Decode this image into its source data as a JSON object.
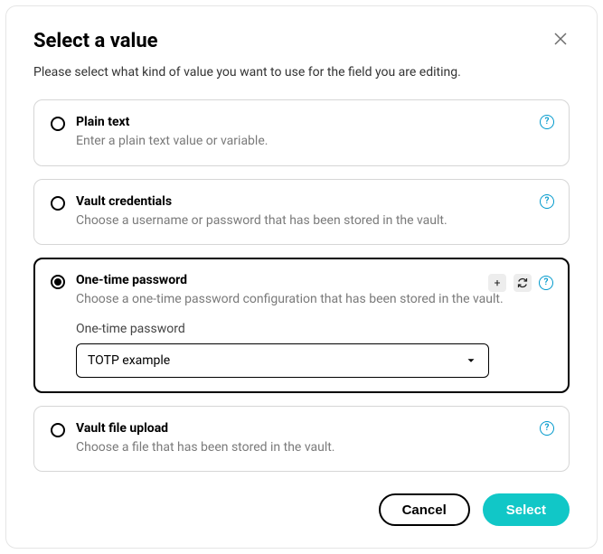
{
  "modal": {
    "title": "Select a value",
    "subtitle": "Please select what kind of value you want to use for the field you are editing."
  },
  "options": [
    {
      "key": "plain-text",
      "title": "Plain text",
      "desc": "Enter a plain text value or variable.",
      "selected": false,
      "has_add": false,
      "has_refresh": false
    },
    {
      "key": "vault-credentials",
      "title": "Vault credentials",
      "desc": "Choose a username or password that has been stored in the vault.",
      "selected": false,
      "has_add": false,
      "has_refresh": false
    },
    {
      "key": "one-time-password",
      "title": "One-time password",
      "desc": "Choose a one-time password configuration that has been stored in the vault.",
      "selected": true,
      "has_add": true,
      "has_refresh": true,
      "field_label": "One-time password",
      "selected_value": "TOTP example"
    },
    {
      "key": "vault-file-upload",
      "title": "Vault file upload",
      "desc": "Choose a file that has been stored in the vault.",
      "selected": false,
      "has_add": false,
      "has_refresh": false
    }
  ],
  "buttons": {
    "cancel": "Cancel",
    "select": "Select"
  },
  "icons": {
    "help": "?",
    "plus": "+"
  }
}
